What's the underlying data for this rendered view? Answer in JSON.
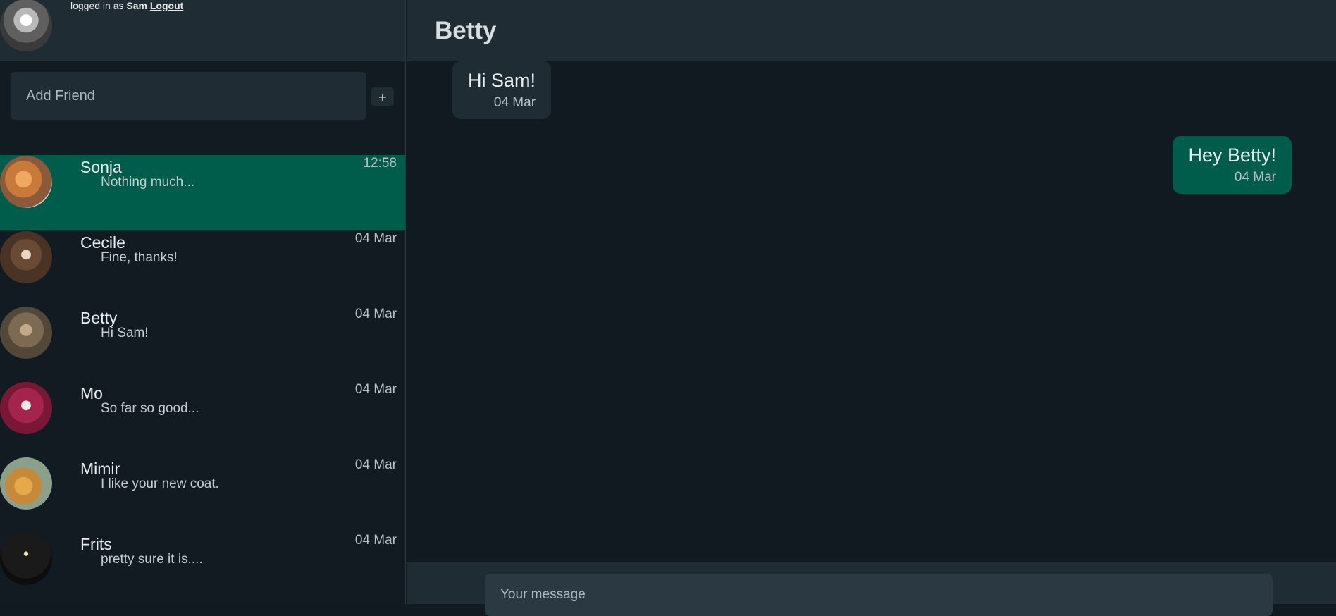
{
  "me": {
    "login_prefix": "logged in as",
    "username": "Sam",
    "logout_label": "Logout"
  },
  "add_friend": {
    "placeholder": "Add Friend",
    "button_label": "+"
  },
  "contacts": [
    {
      "name": "Sonja",
      "preview": "Nothing much...",
      "time": "12:58",
      "active": true
    },
    {
      "name": "Cecile",
      "preview": "Fine, thanks!",
      "time": "04 Mar",
      "active": false
    },
    {
      "name": "Betty",
      "preview": "Hi Sam!",
      "time": "04 Mar",
      "active": false
    },
    {
      "name": "Mo",
      "preview": "So far so good...",
      "time": "04 Mar",
      "active": false
    },
    {
      "name": "Mimir",
      "preview": "I like your new coat.",
      "time": "04 Mar",
      "active": false
    },
    {
      "name": "Frits",
      "preview": "pretty sure it is....",
      "time": "04 Mar",
      "active": false
    }
  ],
  "chat": {
    "title": "Betty",
    "messages": [
      {
        "direction": "incoming",
        "text": "Hi Sam!",
        "date": "04 Mar"
      },
      {
        "direction": "outgoing",
        "text": "Hey Betty!",
        "date": "04 Mar"
      }
    ],
    "composer_placeholder": "Your message"
  },
  "colors": {
    "background": "#111b21",
    "panel": "#202c33",
    "accent": "#005c4b"
  }
}
